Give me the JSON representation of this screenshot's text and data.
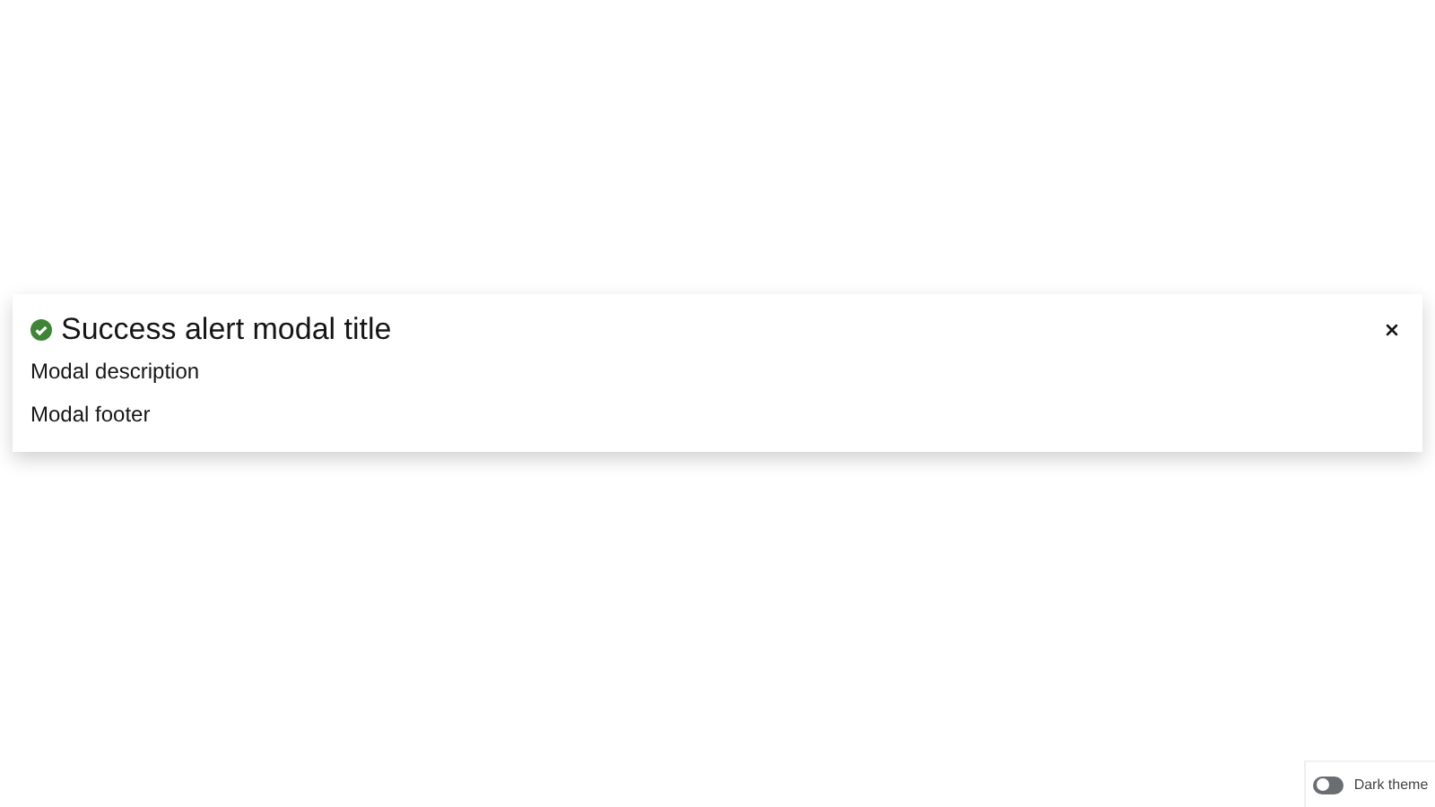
{
  "modal": {
    "kind": "success",
    "title": "Success alert modal title",
    "description": "Modal description",
    "footer": "Modal footer"
  },
  "theme_switch": {
    "label": "Dark theme",
    "on": false
  }
}
